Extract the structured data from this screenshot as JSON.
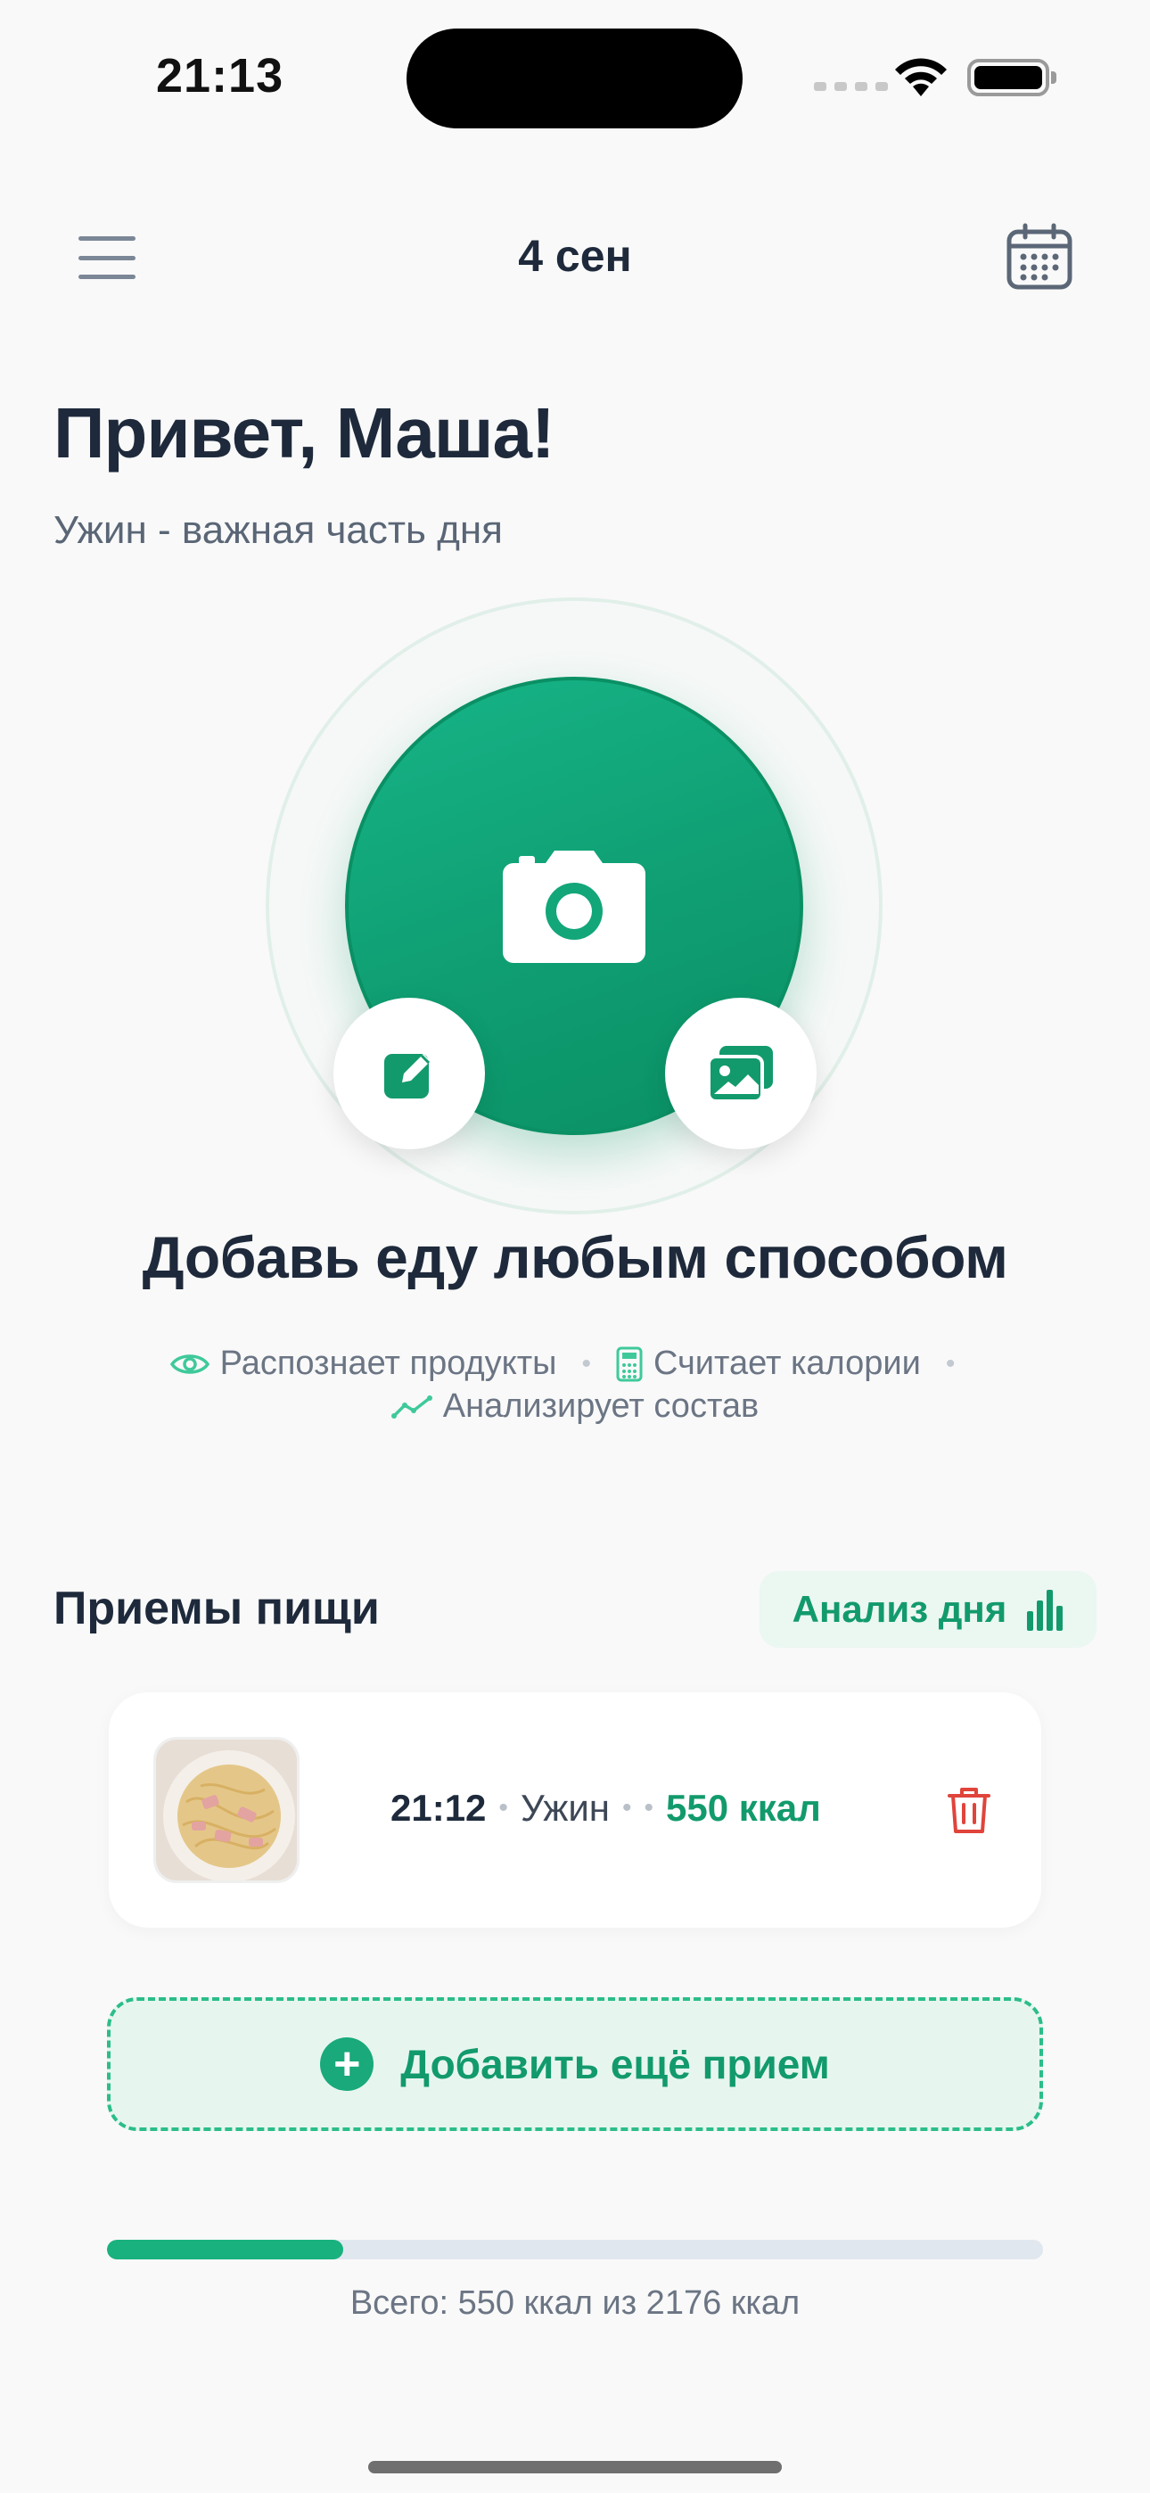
{
  "status_bar": {
    "time": "21:13",
    "icons": [
      "cellular-icon",
      "wifi-icon",
      "battery-icon"
    ]
  },
  "header": {
    "date": "4 сен",
    "menu_icon": "hamburger-icon",
    "calendar_icon": "calendar-icon"
  },
  "greeting": {
    "title": "Привет, Маша!",
    "subtitle": "Ужин - важная часть дня"
  },
  "capture": {
    "title": "Добавь еду любым способом",
    "features": [
      {
        "icon": "eye-icon",
        "label": "Распознает продукты"
      },
      {
        "icon": "calculator-icon",
        "label": "Считает калории"
      },
      {
        "icon": "trend-icon",
        "label": "Анализирует состав"
      }
    ]
  },
  "meals": {
    "title": "Приемы пищи",
    "analysis_label": "Анализ дня",
    "items": [
      {
        "time": "21:12",
        "type": "Ужин",
        "kcal": "550 ккал"
      }
    ],
    "add_more_label": "Добавить ещё прием"
  },
  "totals": {
    "text": "Всего: 550 ккал из 2176 ккал",
    "consumed": 550,
    "goal": 2176
  },
  "colors": {
    "accent": "#129a6d",
    "accent_light": "#e6f6ef",
    "danger": "#e0443b",
    "text": "#1e2a3b",
    "muted": "#6b7584"
  }
}
